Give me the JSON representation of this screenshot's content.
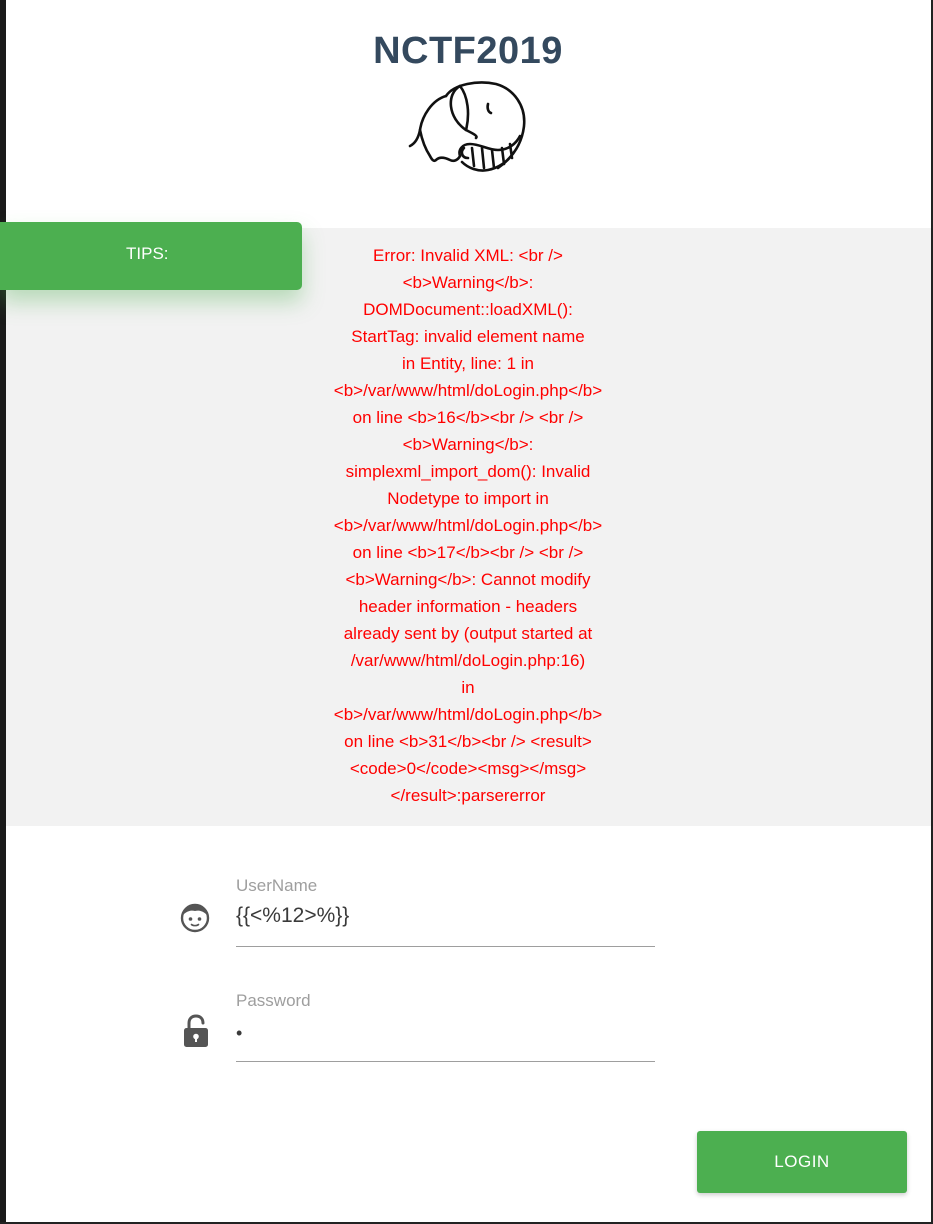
{
  "header": {
    "title": "NCTF2019",
    "logo_icon": "elephant-icon"
  },
  "tips": {
    "tab_label": "TIPS:",
    "error_lines": [
      "Error: Invalid XML: <br />",
      "<b>Warning</b>:",
      "DOMDocument::loadXML():",
      "StartTag: invalid element name",
      "in Entity, line: 1 in",
      "<b>/var/www/html/doLogin.php</b>",
      "on line <b>16</b><br /> <br />",
      "<b>Warning</b>:",
      "simplexml_import_dom(): Invalid",
      "Nodetype to import in",
      "<b>/var/www/html/doLogin.php</b>",
      "on line <b>17</b><br /> <br />",
      "<b>Warning</b>: Cannot modify",
      "header information - headers",
      "already sent by (output started at",
      "/var/www/html/doLogin.php:16)",
      "in",
      "<b>/var/www/html/doLogin.php</b>",
      "on line <b>31</b><br /> <result>",
      "<code>0</code><msg></msg>",
      "</result>:parsererror"
    ],
    "error_color": "#ff0000",
    "accent_color": "#4caf50"
  },
  "form": {
    "username": {
      "label": "UserName",
      "value": "{{<%12>%}}",
      "icon": "face-icon"
    },
    "password": {
      "label": "Password",
      "value": "•",
      "icon": "unlock-icon"
    },
    "login_label": "LOGIN"
  }
}
